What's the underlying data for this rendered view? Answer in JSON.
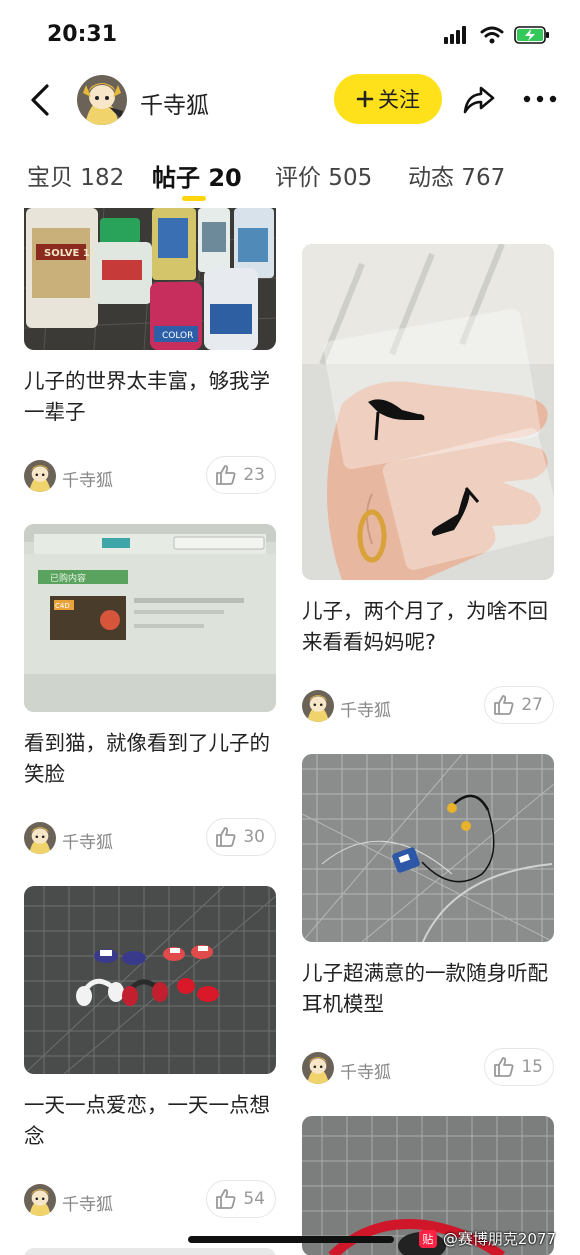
{
  "status_bar": {
    "time": "20:31"
  },
  "header": {
    "username": "千寺狐",
    "follow_label": "关注"
  },
  "tabs": [
    {
      "label": "宝贝 182"
    },
    {
      "label": "帖子 20",
      "active": true
    },
    {
      "label": "评价 505"
    },
    {
      "label": "动态 767"
    }
  ],
  "accent_color": "#ffe11b",
  "posts": [
    {
      "title": "儿子的世界太丰富，够我学一辈子",
      "author": "千寺狐",
      "likes": "23"
    },
    {
      "title": "看到猫，就像看到了儿子的笑脸",
      "author": "千寺狐",
      "likes": "30"
    },
    {
      "title": "一天一点爱恋，一天一点想念",
      "author": "千寺狐",
      "likes": "54"
    },
    {
      "title": "儿子，两个月了，为啥不回来看看妈妈呢?",
      "author": "千寺狐",
      "likes": "27"
    },
    {
      "title": "儿子超满意的一款随身听配耳机模型",
      "author": "千寺狐",
      "likes": "15"
    }
  ],
  "screen_text": {
    "bottle_label": "SOLVE 110",
    "bottle_color": "COLOR",
    "screen_menu": "已购内容",
    "course_tag": "C4D"
  },
  "watermark": {
    "badge": "贴",
    "text": "@赛博朋克2077"
  }
}
